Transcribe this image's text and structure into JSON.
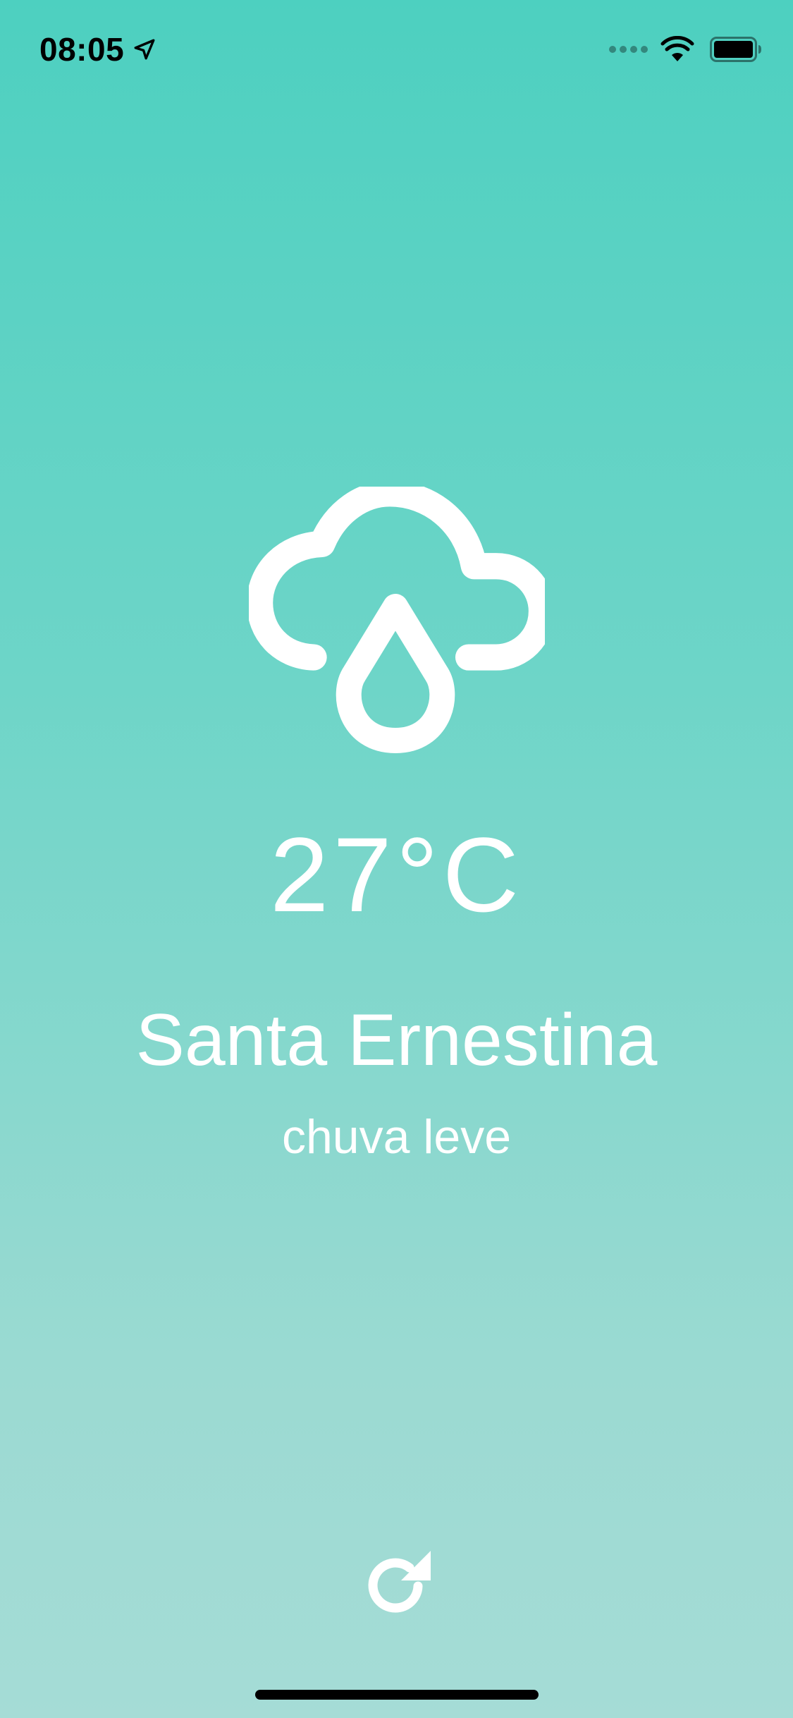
{
  "status_bar": {
    "time": "08:05",
    "icons": [
      "location-arrow-icon",
      "signal-icon",
      "wifi-icon",
      "battery-icon"
    ]
  },
  "weather": {
    "icon": "cloud-rain-icon",
    "temperature": "27°C",
    "city": "Santa Ernestina",
    "description": "chuva leve"
  },
  "actions": {
    "refresh_icon": "refresh-icon"
  },
  "colors": {
    "gradient_top": "#4dd0c0",
    "gradient_bottom": "#a5dcd6",
    "foreground": "#ffffff"
  }
}
